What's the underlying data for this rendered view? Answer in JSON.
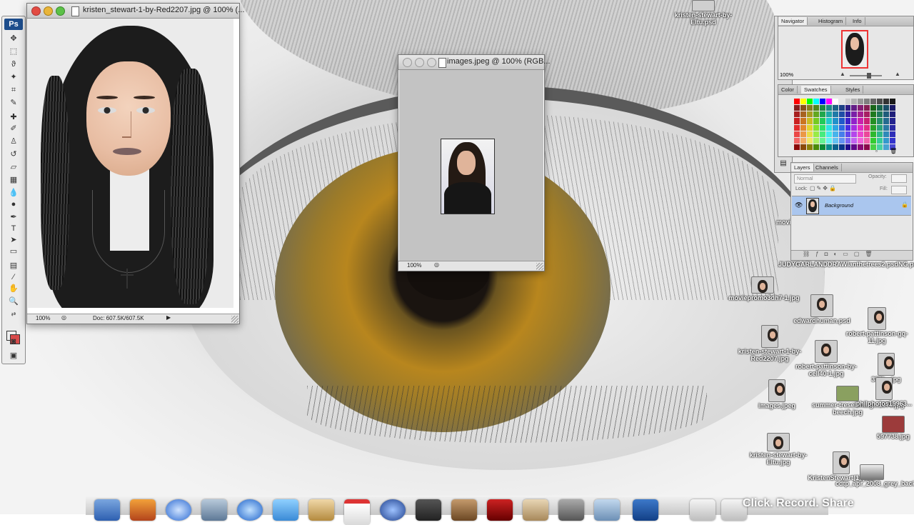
{
  "app": {
    "name": "Ps",
    "accent": "#1d4d8c"
  },
  "main_document": {
    "title": "kristen_stewart-1-by-Red2207.jpg @ 100% (...",
    "status_zoom": "100%",
    "status_doc": "Doc: 607.5K/607.5K"
  },
  "second_document": {
    "title": "images.jpeg @ 100% (RGB...",
    "status_zoom": "100%"
  },
  "navigator_panel": {
    "tabs": [
      "Navigator",
      "Histogram",
      "Info"
    ],
    "zoom": "100%"
  },
  "swatches_panel": {
    "tabs": [
      "Color",
      "Swatches",
      "Styles"
    ]
  },
  "layers_panel": {
    "tabs": [
      "Layers",
      "Channels"
    ],
    "blend_mode": "Normal",
    "opacity_label": "Opacity:",
    "lock_label": "Lock:",
    "fill_label": "Fill:",
    "layer_name": "Background"
  },
  "desktop_icons": [
    {
      "label": "kristen-stewart-by-Eltu.psd"
    },
    {
      "label": "JUDYGARLANDDRAWIanthetrees2.psdNG.psd"
    },
    {
      "label": "moviepromo3dh7-1.jpg"
    },
    {
      "label": "edwardhuman.psd"
    },
    {
      "label": "robert-pattinson-gq-11.jpg"
    },
    {
      "label": "kristen-stewart-1-by-Red2207.jpg"
    },
    {
      "label": "robert-pattinson-by-cell40-1.jpg"
    },
    {
      "label": "333b...jpg"
    },
    {
      "label": "images.jpeg"
    },
    {
      "label": "summer-treselena-g...1070.jpg"
    },
    {
      "label": "beech.jpg"
    },
    {
      "label": "philphotos19963..."
    },
    {
      "label": "597738.jpg"
    },
    {
      "label": "kristen-stewart-by-Eltu.jpg"
    },
    {
      "label": "KristenStewart(1).psd"
    },
    {
      "label": "cdtp_apr_2008_grey_background4.jpg"
    },
    {
      "label": "movi..."
    }
  ],
  "watermark": "Click. Record. Share"
}
